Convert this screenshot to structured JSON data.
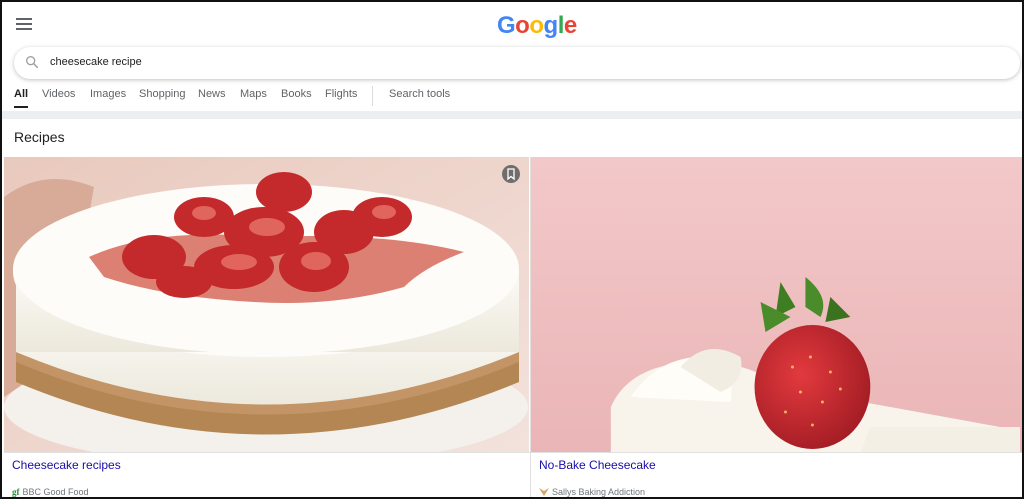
{
  "header": {
    "logo_letters": [
      "G",
      "o",
      "o",
      "g",
      "l",
      "e"
    ],
    "logo_colors": [
      "#4285f4",
      "#ea4335",
      "#fbbc05",
      "#4285f4",
      "#34a853",
      "#ea4335"
    ]
  },
  "search": {
    "query": "cheesecake recipe"
  },
  "tabs": [
    {
      "label": "All",
      "active": true
    },
    {
      "label": "Videos"
    },
    {
      "label": "Images"
    },
    {
      "label": "Shopping"
    },
    {
      "label": "News"
    },
    {
      "label": "Maps"
    },
    {
      "label": "Books"
    },
    {
      "label": "Flights"
    },
    {
      "label": "Search tools"
    }
  ],
  "section": {
    "title": "Recipes"
  },
  "recipes": [
    {
      "title": "Cheesecake recipes",
      "source": "BBC Good Food",
      "source_logo": "gf"
    },
    {
      "title": "No-Bake Cheesecake",
      "source": "Sallys Baking Addiction"
    }
  ],
  "colors": {
    "link": "#1a0dab",
    "pink_bg": "#f1c3c5",
    "strawberry": "#c8202c"
  }
}
